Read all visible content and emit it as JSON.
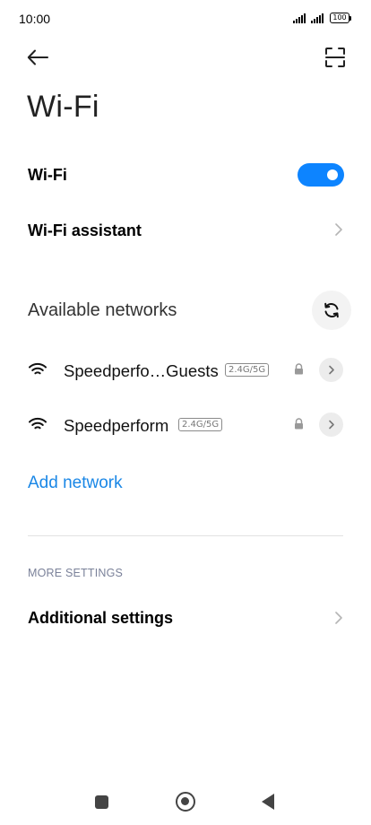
{
  "status_bar": {
    "time": "10:00",
    "battery": "100"
  },
  "header": {
    "title": "Wi-Fi",
    "back_icon": "arrow-left-icon",
    "scan_icon": "qr-scan-icon"
  },
  "wifi_toggle": {
    "label": "Wi-Fi",
    "enabled": true,
    "accent_color": "#0d84ff"
  },
  "wifi_assistant": {
    "label": "Wi-Fi assistant"
  },
  "available_networks": {
    "title": "Available networks",
    "refresh_icon": "refresh-icon",
    "networks": [
      {
        "name": "Speedperfo…Guests",
        "band": "2.4G/5G",
        "secured": true
      },
      {
        "name": "Speedperform",
        "band": "2.4G/5G",
        "secured": true
      }
    ]
  },
  "add_network": {
    "label": "Add network",
    "color": "#1a87e6"
  },
  "more_settings": {
    "section_label": "MORE SETTINGS",
    "additional_settings_label": "Additional settings"
  },
  "nav_bar": {
    "recents_icon": "square-icon",
    "home_icon": "home-circle-icon",
    "back_icon": "triangle-back-icon"
  }
}
